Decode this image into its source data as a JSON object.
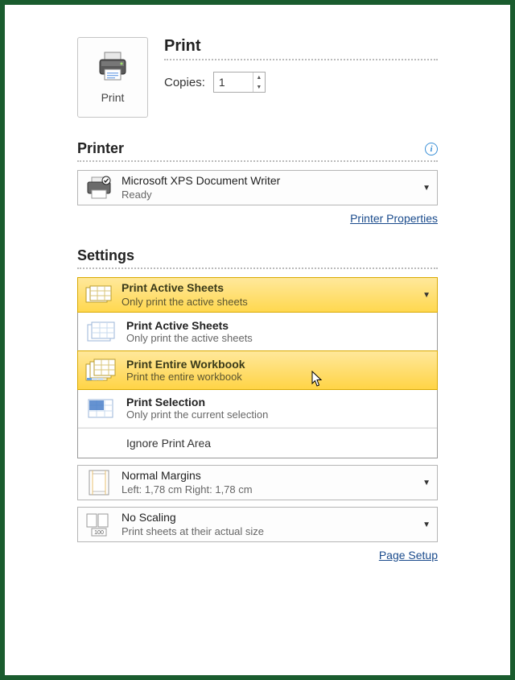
{
  "print": {
    "button_label": "Print",
    "title": "Print",
    "copies_label": "Copies:",
    "copies_value": "1"
  },
  "printer": {
    "section_title": "Printer",
    "name": "Microsoft XPS Document Writer",
    "status": "Ready",
    "properties_link": "Printer Properties"
  },
  "settings": {
    "section_title": "Settings",
    "selected": {
      "title": "Print Active Sheets",
      "desc": "Only print the active sheets"
    },
    "options": [
      {
        "title": "Print Active Sheets",
        "desc": "Only print the active sheets"
      },
      {
        "title": "Print Entire Workbook",
        "desc": "Print the entire workbook"
      },
      {
        "title": "Print Selection",
        "desc": "Only print the current selection"
      }
    ],
    "ignore": "Ignore Print Area",
    "margins": {
      "title": "Normal Margins",
      "desc": "Left: 1,78 cm   Right: 1,78 cm"
    },
    "scaling": {
      "title": "No Scaling",
      "desc": "Print sheets at their actual size"
    },
    "page_setup_link": "Page Setup"
  }
}
